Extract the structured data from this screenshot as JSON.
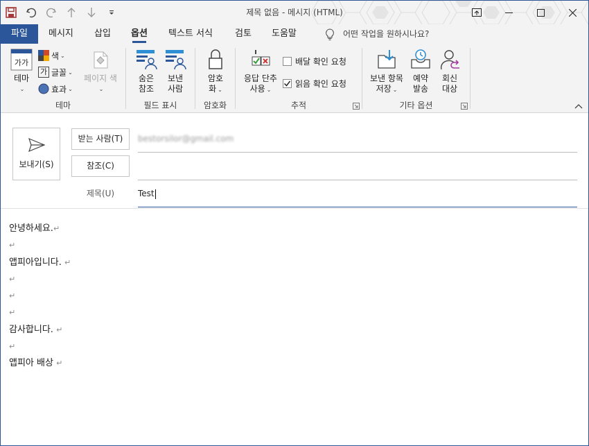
{
  "window": {
    "title": "제목 없음 - 메시지 (HTML)",
    "accent": "#2b579a"
  },
  "qat": {
    "icons": [
      "save-icon",
      "undo-icon",
      "redo-icon",
      "up-icon",
      "down-icon",
      "customize-icon"
    ]
  },
  "tabs": [
    {
      "label": "파일"
    },
    {
      "label": "메시지"
    },
    {
      "label": "삽입"
    },
    {
      "label": "옵션"
    },
    {
      "label": "텍스트 서식"
    },
    {
      "label": "검토"
    },
    {
      "label": "도움말"
    }
  ],
  "tell_me": "어떤 작업을 원하시나요?",
  "ribbon": {
    "theme_group": {
      "label": "테마",
      "theme_btn": "테마",
      "theme_icon_text": "가가",
      "colors": "색",
      "fonts": "글꼴",
      "fonts_icon_text": "가",
      "effects": "효과",
      "page_color": "페이지 색"
    },
    "fields_group": {
      "label": "필드 표시",
      "bcc_l1": "숨은",
      "bcc_l2": "참조",
      "from_l1": "보낸",
      "from_l2": "사람"
    },
    "encrypt_group": {
      "label": "암호화",
      "btn_l1": "암호",
      "btn_l2": "화"
    },
    "tracking_group": {
      "label": "추적",
      "voting_l1": "응답 단추",
      "voting_l2": "사용",
      "delivery": "배달 확인 요청",
      "read": "읽음 확인 요청",
      "delivery_checked": false,
      "read_checked": true
    },
    "more_group": {
      "label": "기타 옵션",
      "save_l1": "보낸 항목",
      "save_l2": "저장",
      "delay_l1": "예약",
      "delay_l2": "발송",
      "reply_l1": "회신",
      "reply_l2": "대상"
    }
  },
  "compose": {
    "send": "보내기(S)",
    "to_btn": "받는 사람(T)",
    "cc_btn": "참조(C)",
    "subject_label": "제목(U)",
    "to_value": "bestorsilor@gmail.com",
    "subject_value": "Test"
  },
  "mail_body": {
    "lines": [
      "안녕하세요.",
      "",
      "앱피아입니다. ",
      "",
      "",
      "",
      "감사합니다. ",
      "",
      "앱피아 배상 "
    ],
    "paragraph_mark": "↵"
  }
}
